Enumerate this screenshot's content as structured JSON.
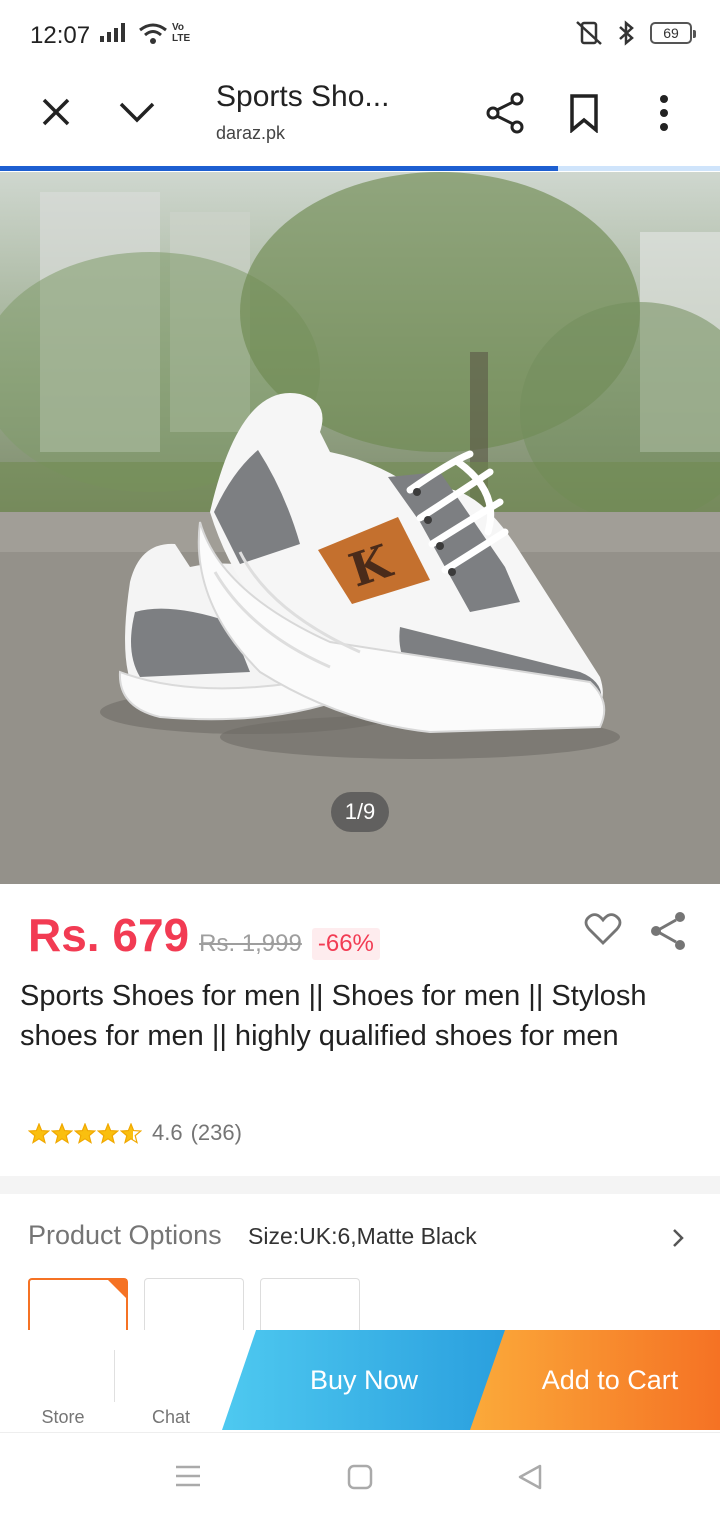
{
  "status_bar": {
    "time": "12:07",
    "network_label": "Vo LTE",
    "battery": "69"
  },
  "browser": {
    "page_title": "Sports Sho...",
    "url": "daraz.pk",
    "load_progress": 0.775
  },
  "hero": {
    "image_counter": "1/9",
    "logo_text": "K"
  },
  "product": {
    "price": "Rs. 679",
    "original_price": "Rs. 1,999",
    "discount": "-66%",
    "title": "Sports Shoes for men || Shoes for men || Stylosh shoes for men || highly qualified shoes for men",
    "rating_value": "4.6",
    "rating_count": "(236)",
    "stars": 4.6,
    "accent_color": "#f23b53"
  },
  "options": {
    "label": "Product Options",
    "value": "Size:UK:6,Matte Black",
    "selected_color": "#f57224"
  },
  "action_bar": {
    "store_label": "Store",
    "chat_label": "Chat",
    "buy_now_label": "Buy Now",
    "add_to_cart_label": "Add to Cart"
  },
  "icons": {
    "close": "close-icon",
    "collapse": "chevron-down-icon",
    "share": "share-icon",
    "bookmark": "bookmark-icon",
    "menu": "more-vertical-icon",
    "wishlist": "heart-icon"
  }
}
